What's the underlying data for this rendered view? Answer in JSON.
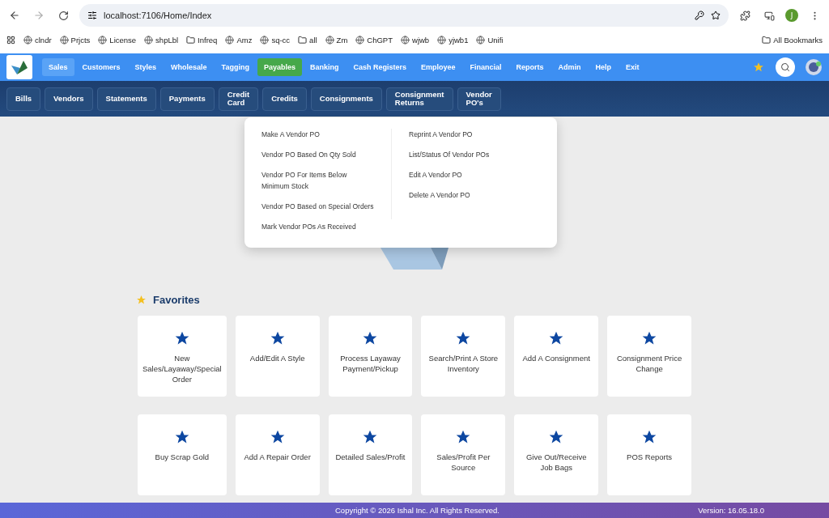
{
  "browser": {
    "url": "localhost:7106/Home/Index",
    "profile_initial": "J",
    "bookmarks": [
      {
        "label": "clndr",
        "kind": "site"
      },
      {
        "label": "Prjcts",
        "kind": "site"
      },
      {
        "label": "License",
        "kind": "site"
      },
      {
        "label": "shpLbl",
        "kind": "site"
      },
      {
        "label": "Infreq",
        "kind": "folder"
      },
      {
        "label": "Amz",
        "kind": "site"
      },
      {
        "label": "sq-cc",
        "kind": "site"
      },
      {
        "label": "all",
        "kind": "folder"
      },
      {
        "label": "Zm",
        "kind": "site"
      },
      {
        "label": "ChGPT",
        "kind": "site"
      },
      {
        "label": "wjwb",
        "kind": "site"
      },
      {
        "label": "yjwb1",
        "kind": "site"
      },
      {
        "label": "Unifi",
        "kind": "site"
      }
    ],
    "all_bookmarks": "All Bookmarks"
  },
  "nav": {
    "items": [
      {
        "label": "Sales",
        "selected": false,
        "highlighted": true
      },
      {
        "label": "Customers",
        "selected": false,
        "highlighted": false
      },
      {
        "label": "Styles",
        "selected": false,
        "highlighted": false
      },
      {
        "label": "Wholesale",
        "selected": false,
        "highlighted": false
      },
      {
        "label": "Tagging",
        "selected": false,
        "highlighted": false
      },
      {
        "label": "Payables",
        "selected": true,
        "highlighted": false
      },
      {
        "label": "Banking",
        "selected": false,
        "highlighted": false
      },
      {
        "label": "Cash Registers",
        "selected": false,
        "highlighted": false
      },
      {
        "label": "Employee",
        "selected": false,
        "highlighted": false
      },
      {
        "label": "Financial",
        "selected": false,
        "highlighted": false
      },
      {
        "label": "Reports",
        "selected": false,
        "highlighted": false
      },
      {
        "label": "Admin",
        "selected": false,
        "highlighted": false
      },
      {
        "label": "Help",
        "selected": false,
        "highlighted": false
      },
      {
        "label": "Exit",
        "selected": false,
        "highlighted": false
      }
    ]
  },
  "subnav": {
    "items": [
      "Bills",
      "Vendors",
      "Statements",
      "Payments",
      "Credit Card",
      "Credits",
      "Consignments",
      "Consignment Returns",
      "Vendor PO's"
    ]
  },
  "dropdown": {
    "left": [
      "Make A Vendor PO",
      "Vendor PO Based On Qty Sold",
      "Vendor PO For Items Below Minimum Stock",
      "Vendor PO Based on Special Orders",
      "Mark Vendor POs As Received"
    ],
    "right": [
      "Reprint A Vendor PO",
      "List/Status Of Vendor POs",
      "Edit A Vendor PO",
      "Delete A Vendor PO"
    ]
  },
  "favorites": {
    "title": "Favorites",
    "items": [
      "New Sales/Layaway/Special Order",
      "Add/Edit A Style",
      "Process Layaway Payment/Pickup",
      "Search/Print A Store Inventory",
      "Add A Consignment",
      "Consignment Price Change",
      "Buy Scrap Gold",
      "Add A Repair Order",
      "Detailed Sales/Profit",
      "Sales/Profit Per Source",
      "Give Out/Receive Job Bags",
      "POS Reports"
    ]
  },
  "footer": {
    "copyright": "Copyright © 2026 Ishal Inc. All Rights Reserved.",
    "version": "Version: 16.05.18.0"
  }
}
